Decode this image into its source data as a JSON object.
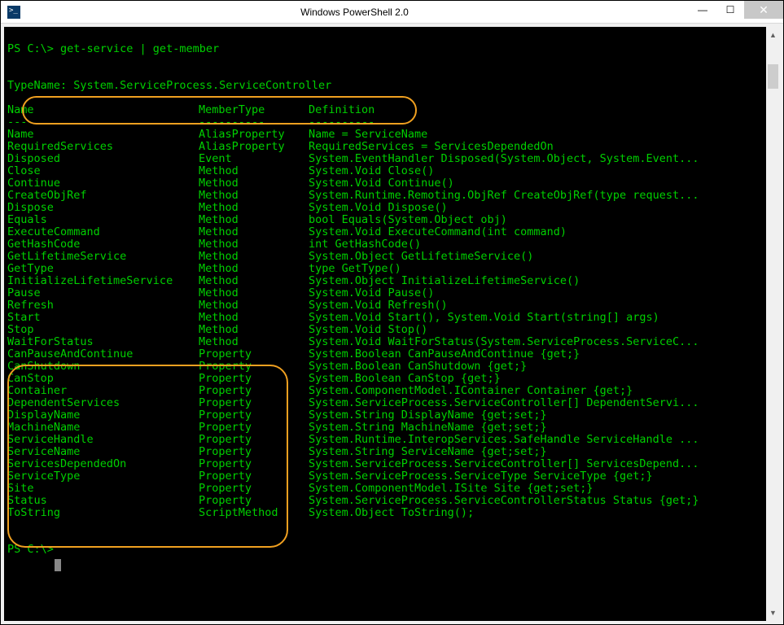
{
  "window": {
    "title": "Windows PowerShell 2.0"
  },
  "prompt1": "PS C:\\> get-service | get-member",
  "typename": "   TypeName: System.ServiceProcess.ServiceController",
  "header": {
    "c0": "Name",
    "c1": "MemberType",
    "c2": "Definition"
  },
  "dashes": {
    "c0": "----",
    "c1": "----------",
    "c2": "----------"
  },
  "rows": [
    {
      "n": "Name",
      "t": "AliasProperty",
      "d": "Name = ServiceName"
    },
    {
      "n": "RequiredServices",
      "t": "AliasProperty",
      "d": "RequiredServices = ServicesDependedOn"
    },
    {
      "n": "Disposed",
      "t": "Event",
      "d": "System.EventHandler Disposed(System.Object, System.Event..."
    },
    {
      "n": "Close",
      "t": "Method",
      "d": "System.Void Close()"
    },
    {
      "n": "Continue",
      "t": "Method",
      "d": "System.Void Continue()"
    },
    {
      "n": "CreateObjRef",
      "t": "Method",
      "d": "System.Runtime.Remoting.ObjRef CreateObjRef(type request..."
    },
    {
      "n": "Dispose",
      "t": "Method",
      "d": "System.Void Dispose()"
    },
    {
      "n": "Equals",
      "t": "Method",
      "d": "bool Equals(System.Object obj)"
    },
    {
      "n": "ExecuteCommand",
      "t": "Method",
      "d": "System.Void ExecuteCommand(int command)"
    },
    {
      "n": "GetHashCode",
      "t": "Method",
      "d": "int GetHashCode()"
    },
    {
      "n": "GetLifetimeService",
      "t": "Method",
      "d": "System.Object GetLifetimeService()"
    },
    {
      "n": "GetType",
      "t": "Method",
      "d": "type GetType()"
    },
    {
      "n": "InitializeLifetimeService",
      "t": "Method",
      "d": "System.Object InitializeLifetimeService()"
    },
    {
      "n": "Pause",
      "t": "Method",
      "d": "System.Void Pause()"
    },
    {
      "n": "Refresh",
      "t": "Method",
      "d": "System.Void Refresh()"
    },
    {
      "n": "Start",
      "t": "Method",
      "d": "System.Void Start(), System.Void Start(string[] args)"
    },
    {
      "n": "Stop",
      "t": "Method",
      "d": "System.Void Stop()"
    },
    {
      "n": "WaitForStatus",
      "t": "Method",
      "d": "System.Void WaitForStatus(System.ServiceProcess.ServiceC..."
    },
    {
      "n": "CanPauseAndContinue",
      "t": "Property",
      "d": "System.Boolean CanPauseAndContinue {get;}"
    },
    {
      "n": "CanShutdown",
      "t": "Property",
      "d": "System.Boolean CanShutdown {get;}"
    },
    {
      "n": "CanStop",
      "t": "Property",
      "d": "System.Boolean CanStop {get;}"
    },
    {
      "n": "Container",
      "t": "Property",
      "d": "System.ComponentModel.IContainer Container {get;}"
    },
    {
      "n": "DependentServices",
      "t": "Property",
      "d": "System.ServiceProcess.ServiceController[] DependentServi..."
    },
    {
      "n": "DisplayName",
      "t": "Property",
      "d": "System.String DisplayName {get;set;}"
    },
    {
      "n": "MachineName",
      "t": "Property",
      "d": "System.String MachineName {get;set;}"
    },
    {
      "n": "ServiceHandle",
      "t": "Property",
      "d": "System.Runtime.InteropServices.SafeHandle ServiceHandle ..."
    },
    {
      "n": "ServiceName",
      "t": "Property",
      "d": "System.String ServiceName {get;set;}"
    },
    {
      "n": "ServicesDependedOn",
      "t": "Property",
      "d": "System.ServiceProcess.ServiceController[] ServicesDepend..."
    },
    {
      "n": "ServiceType",
      "t": "Property",
      "d": "System.ServiceProcess.ServiceType ServiceType {get;}"
    },
    {
      "n": "Site",
      "t": "Property",
      "d": "System.ComponentModel.ISite Site {get;set;}"
    },
    {
      "n": "Status",
      "t": "Property",
      "d": "System.ServiceProcess.ServiceControllerStatus Status {get;}"
    },
    {
      "n": "ToString",
      "t": "ScriptMethod",
      "d": "System.Object ToString();"
    }
  ],
  "prompt2": "PS C:\\>"
}
